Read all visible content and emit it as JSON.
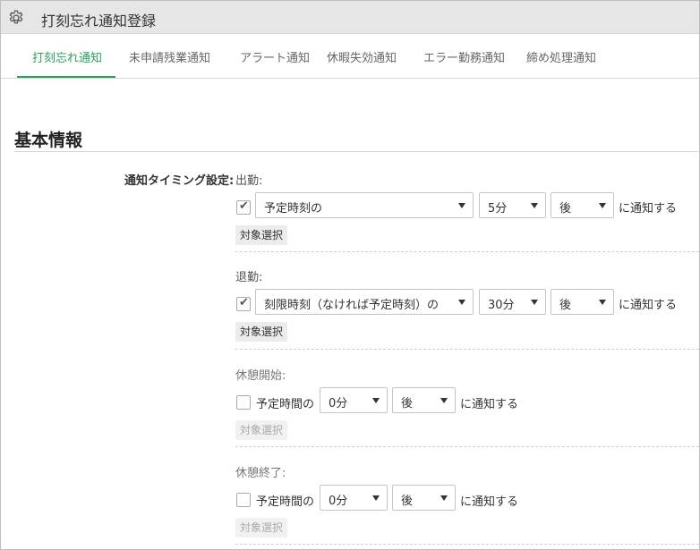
{
  "window": {
    "title": "打刻忘れ通知登録",
    "icon": "gear-icon"
  },
  "tabs": [
    {
      "label": "打刻忘れ通知",
      "active": true
    },
    {
      "label": "未申請残業通知",
      "active": false
    },
    {
      "label": "アラート通知",
      "active": false
    },
    {
      "label": "休暇失効通知",
      "active": false
    },
    {
      "label": "エラー勤務通知",
      "active": false
    },
    {
      "label": "締め処理通知",
      "active": false
    }
  ],
  "colors": {
    "accent": "#2e9e5b",
    "titlebar": "#e6e6e6"
  },
  "section": {
    "title": "基本情報"
  },
  "field": {
    "label": "通知タイミング設定:"
  },
  "groups": {
    "clock_in": {
      "label": "出勤:",
      "checked": true,
      "base_select": "予定時刻の",
      "offset_select": "5分",
      "direction_select": "後",
      "suffix": "に通知する",
      "target_button": "対象選択"
    },
    "clock_out": {
      "label": "退勤:",
      "checked": true,
      "base_select": "刻限時刻（なければ予定時刻）の",
      "offset_select": "30分",
      "direction_select": "後",
      "suffix": "に通知する",
      "target_button": "対象選択"
    },
    "break_start": {
      "label": "休憩開始:",
      "checked": false,
      "prefix": "予定時間の",
      "offset_select": "0分",
      "direction_select": "後",
      "suffix": "に通知する",
      "target_button": "対象選択"
    },
    "break_end": {
      "label": "休憩終了:",
      "checked": false,
      "prefix": "予定時間の",
      "offset_select": "0分",
      "direction_select": "後",
      "suffix": "に通知する",
      "target_button": "対象選択"
    }
  }
}
